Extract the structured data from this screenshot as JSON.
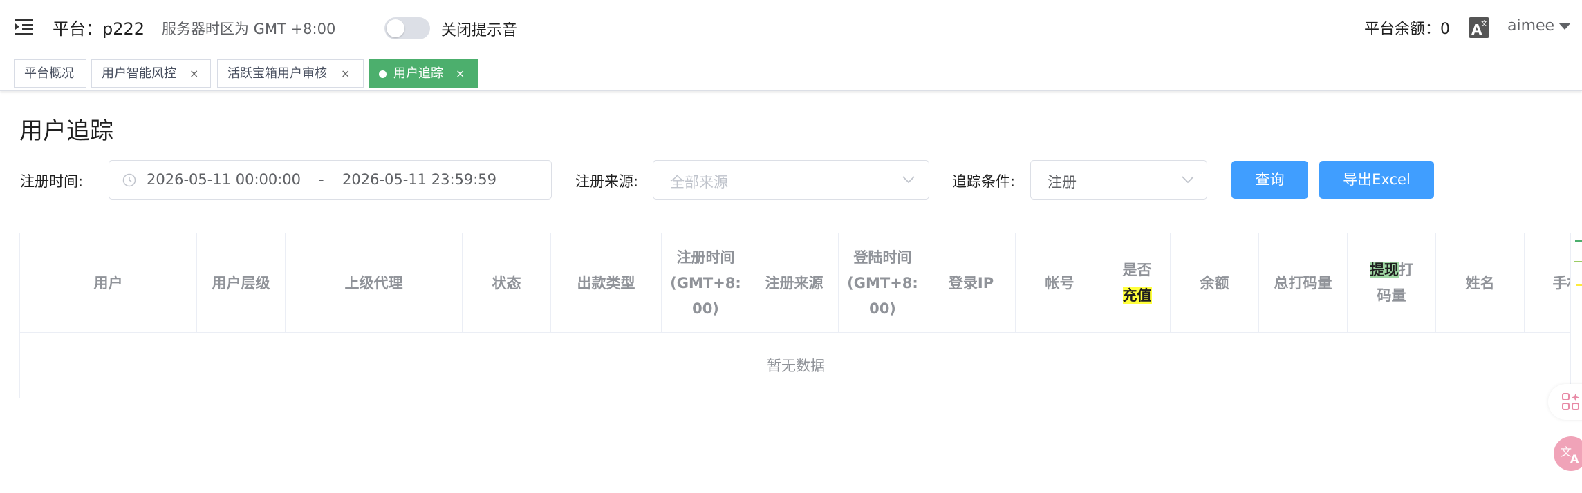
{
  "header": {
    "platform": "平台：p222",
    "server_tz": "服务器时区为 GMT +8:00",
    "sound_toggle_label": "关闭提示音",
    "balance": "平台余额：0",
    "user": "aimee"
  },
  "tags": [
    {
      "label": "平台概况",
      "closable": false,
      "active": false
    },
    {
      "label": "用户智能风控",
      "closable": true,
      "active": false
    },
    {
      "label": "活跃宝箱用户审核",
      "closable": true,
      "active": false
    },
    {
      "label": "用户追踪",
      "closable": true,
      "active": true
    }
  ],
  "tag_close_glyph": "×",
  "page": {
    "title": "用户追踪"
  },
  "filters": {
    "reg_time_label": "注册时间:",
    "date_start": "2026-05-11 00:00:00",
    "date_separator": "-",
    "date_end": "2026-05-11 23:59:59",
    "source_label": "注册来源:",
    "source_placeholder": "全部来源",
    "condition_label": "追踪条件:",
    "condition_value": "注册",
    "query_button": "查询",
    "export_button": "导出Excel"
  },
  "table": {
    "columns": [
      {
        "label": "用户"
      },
      {
        "label": "用户层级"
      },
      {
        "label": "上级代理"
      },
      {
        "label": "状态"
      },
      {
        "label": "出款类型"
      },
      {
        "label": "注册时间\n(GMT+8:\n00)"
      },
      {
        "label": "注册来源"
      },
      {
        "label": "登陆时间\n(GMT+8:\n00)"
      },
      {
        "label": "登录IP"
      },
      {
        "label": "帐号"
      },
      {
        "label_pre": "是否",
        "label_hl": "充值"
      },
      {
        "label": "余额"
      },
      {
        "label": "总打码量"
      },
      {
        "label_hl": "提现",
        "label_post": "打\n码量"
      },
      {
        "label": "姓名"
      },
      {
        "label": "手机"
      }
    ],
    "empty_text": "暂无数据"
  },
  "colors": {
    "primary": "#409eff",
    "active_tag": "#4caf6d",
    "highlight_yellow": "#ffff3b",
    "highlight_green": "#9fd7a3"
  },
  "icons": [
    "menu-toggle-icon",
    "clock-icon",
    "chevron-down-icon",
    "translate-icon",
    "apps-grid-icon"
  ]
}
